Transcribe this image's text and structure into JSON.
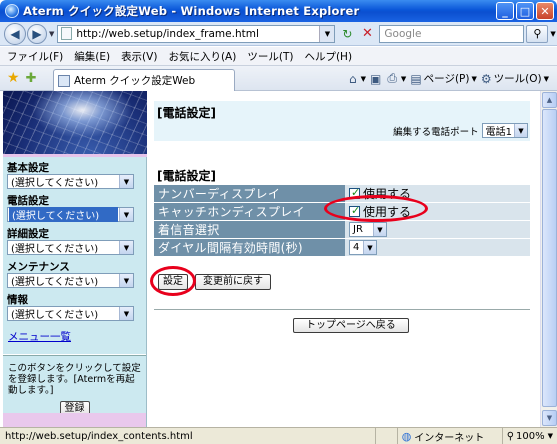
{
  "window": {
    "title": "Aterm クイック設定Web - Windows Internet Explorer",
    "minimize_label": "_",
    "maximize_label": "□",
    "close_label": "✕"
  },
  "toolbar": {
    "address": "http://web.setup/index_frame.html",
    "search_placeholder": "Google"
  },
  "menu": {
    "items": [
      "ファイル(F)",
      "編集(E)",
      "表示(V)",
      "お気に入り(A)",
      "ツール(T)",
      "ヘルプ(H)"
    ]
  },
  "tab": {
    "label": "Aterm クイック設定Web"
  },
  "command_bar": {
    "page_label": "ページ(P)",
    "tools_label": "ツール(O)"
  },
  "sidebar": {
    "groups": [
      {
        "label": "基本設定",
        "value": "(選択してください)",
        "selected": false
      },
      {
        "label": "電話設定",
        "value": "(選択してください)",
        "selected": true
      },
      {
        "label": "詳細設定",
        "value": "(選択してください)",
        "selected": false
      },
      {
        "label": "メンテナンス",
        "value": "(選択してください)",
        "selected": false
      },
      {
        "label": "情報",
        "value": "(選択してください)",
        "selected": false
      }
    ],
    "menu_link": "メニュー一覧",
    "help_text": "このボタンをクリックして設定を登録します。[Atermを再起動します。]",
    "register_button": "登録"
  },
  "main": {
    "header_title": "[電話設定]",
    "port_label": "編集する電話ポート",
    "port_value": "電話1",
    "section_title": "[電話設定]",
    "rows": [
      {
        "name": "ナンバーディスプレイ",
        "type": "checkbox",
        "value": "使用する",
        "checked": true
      },
      {
        "name": "キャッチホンディスプレイ",
        "type": "checkbox",
        "value": "使用する",
        "checked": true
      },
      {
        "name": "着信音選択",
        "type": "select",
        "value": "JR"
      },
      {
        "name": "ダイヤル間隔有効時間(秒)",
        "type": "select",
        "value": "4"
      }
    ],
    "set_button": "設定",
    "revert_button": "変更前に戻す",
    "top_button": "トップページへ戻る"
  },
  "status": {
    "url": "http://web.setup/index_contents.html",
    "zone": "インターネット",
    "zoom": "100%"
  },
  "colors": {
    "title_bar": "#0b4fd0",
    "row_label_bg": "#6f90a8",
    "row_value_bg": "#d9e4ec",
    "sidebar_bg": "#cce9f0",
    "highlight_ring": "#e8001c"
  }
}
